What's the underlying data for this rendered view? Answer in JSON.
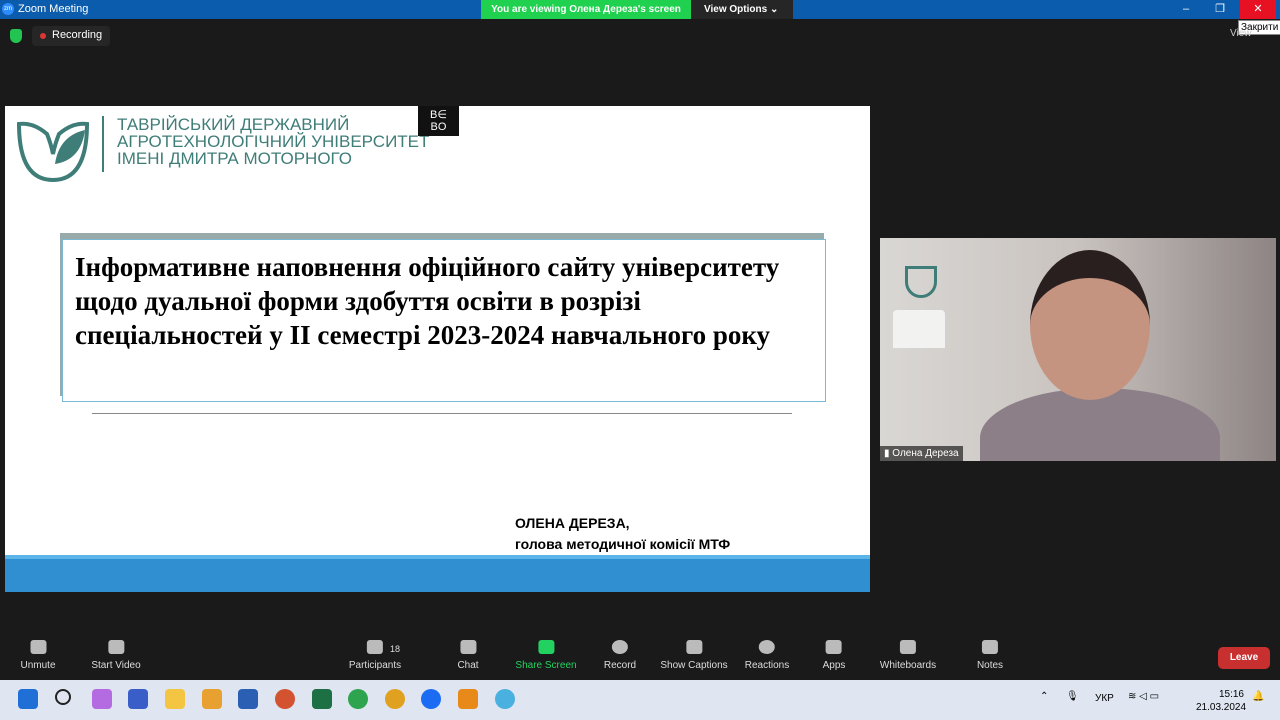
{
  "window": {
    "title": "Zoom Meeting",
    "viewing_banner": "You are viewing Олена Дереза's screen",
    "view_options": "View Options",
    "close_tooltip": "Закрити",
    "view_label": "View"
  },
  "recording": {
    "label": "Recording"
  },
  "slide": {
    "university": [
      "ТАВРІЙСЬКИЙ ДЕРЖАВНИЙ",
      "АГРОТЕХНОЛОГІЧНИЙ УНІВЕРСИТЕТ",
      "ІМЕНІ ДМИТРА МОТОРНОГО"
    ],
    "corner_logo": "BЕ BO",
    "title": "Інформативне наповнення офіційного сайту університету щодо дуальної форми здобуття освіти в розрізі спеціальностей у ІІ семестрі 2023-2024 навчального року",
    "author_name": "ОЛЕНА ДЕРЕЗА,",
    "author_role": "голова методичної комісії МТФ"
  },
  "video": {
    "participant_name": "Олена Дереза"
  },
  "toolbar": {
    "unmute": "Unmute",
    "start_video": "Start Video",
    "participants": "Participants",
    "participants_count": "18",
    "chat": "Chat",
    "share_screen": "Share Screen",
    "record": "Record",
    "show_captions": "Show Captions",
    "reactions": "Reactions",
    "apps": "Apps",
    "whiteboards": "Whiteboards",
    "notes": "Notes",
    "leave": "Leave"
  },
  "taskbar": {
    "language": "УКР",
    "time": "15:16",
    "date": "21.03.2024"
  }
}
